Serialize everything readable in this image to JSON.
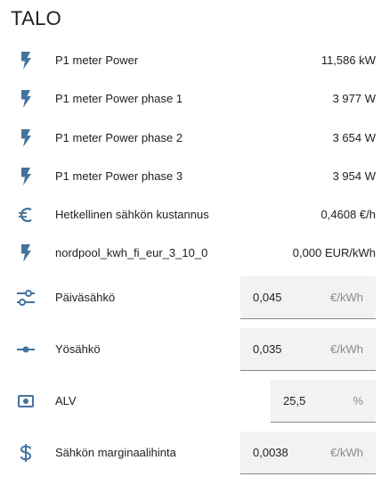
{
  "card": {
    "title": "TALO"
  },
  "entities": [
    {
      "icon": "flash-icon",
      "label": "P1 meter Power",
      "value": "11,586 kW"
    },
    {
      "icon": "flash-icon",
      "label": "P1 meter Power phase 1",
      "value": "3 977 W"
    },
    {
      "icon": "flash-icon",
      "label": "P1 meter Power phase 2",
      "value": "3 654 W"
    },
    {
      "icon": "flash-icon",
      "label": "P1 meter Power phase 3",
      "value": "3 954 W"
    },
    {
      "icon": "euro-icon",
      "label": "Hetkellinen sähkön kustannus",
      "value": "0,4608 €/h"
    },
    {
      "icon": "flash-icon",
      "label": "nordpool_kwh_fi_eur_3_10_0",
      "value": "0,000 EUR/kWh"
    }
  ],
  "inputs": [
    {
      "icon": "tune-icon",
      "label": "Päiväsähkö",
      "value": "0,045",
      "unit": "€/kWh"
    },
    {
      "icon": "slider-icon",
      "label": "Yösähkö",
      "value": "0,035",
      "unit": "€/kWh"
    },
    {
      "icon": "cash-icon",
      "label": "ALV",
      "value": "25,5",
      "unit": "%"
    },
    {
      "icon": "dollar-icon",
      "label": "Sähkön marginaalihinta",
      "value": "0,0038",
      "unit": "€/kWh"
    }
  ],
  "colors": {
    "icon": "#44739e",
    "text": "#212121",
    "input_bg": "#f2f2f2",
    "unit": "#8a8a8a"
  }
}
